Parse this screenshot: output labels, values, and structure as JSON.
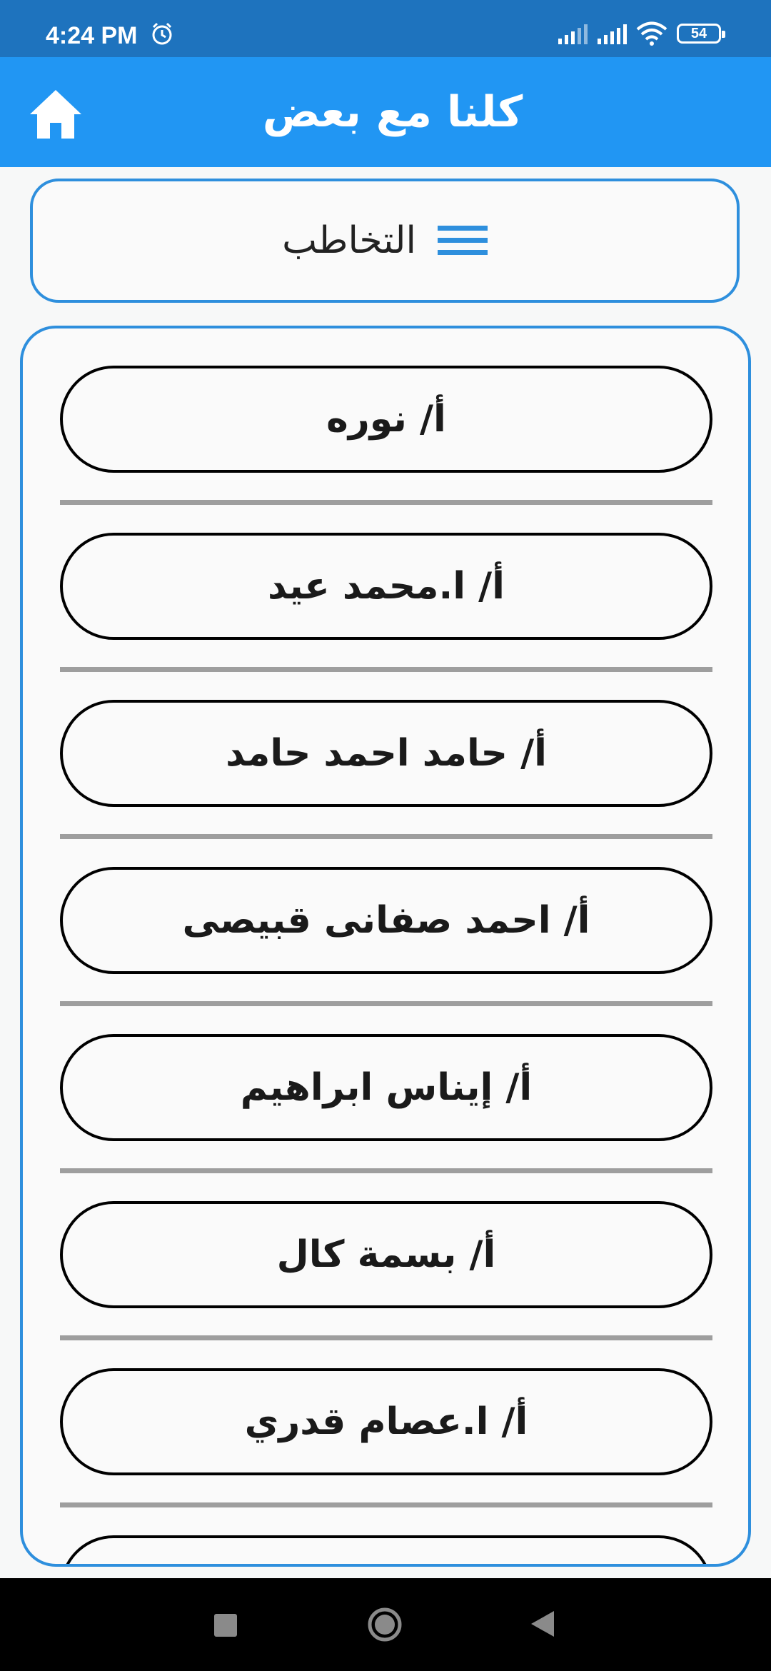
{
  "status_bar": {
    "time": "4:24 PM",
    "battery": "54",
    "icons": [
      "alarm-icon",
      "signal-icon",
      "signal-icon",
      "wifi-icon",
      "battery-icon"
    ]
  },
  "app_bar": {
    "title": "كلنا مع بعض",
    "home_icon": "home-icon",
    "color": "#2196f3"
  },
  "category": {
    "label": "التخاطب",
    "icon": "menu-icon",
    "accent": "#2e8fdd"
  },
  "list": {
    "items": [
      {
        "label": "أ/ نوره"
      },
      {
        "label": "أ/ ا.محمد عيد"
      },
      {
        "label": "أ/ حامد احمد حامد"
      },
      {
        "label": "أ/ احمد صفانى قبيصى"
      },
      {
        "label": "أ/ إيناس ابراهيم"
      },
      {
        "label": "أ/ بسمة كال"
      },
      {
        "label": "أ/ ا.عصام قدري"
      }
    ]
  },
  "nav_bar": {
    "icons": [
      "recent-apps-icon",
      "home-circle-icon",
      "back-icon"
    ]
  }
}
